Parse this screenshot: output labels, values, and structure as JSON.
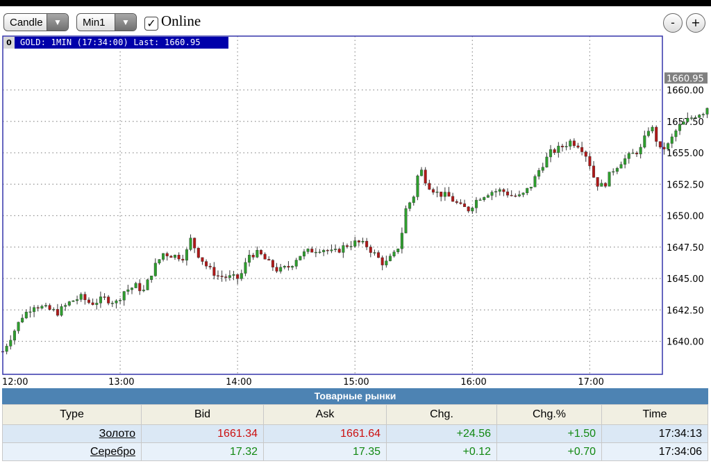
{
  "toolbar": {
    "chart_type": "Candle",
    "interval": "Min1",
    "online_label": "Online",
    "zoom_out": "-",
    "zoom_in": "+"
  },
  "chart_info": {
    "index": "0",
    "text": "GOLD: 1MIN (17:34:00) Last: 1660.95"
  },
  "colors": {
    "up": "#2e9e2e",
    "down": "#b01818",
    "grid": "#909090",
    "frame": "#3333aa",
    "last_tag": "#808080"
  },
  "chart_data": {
    "type": "candlestick",
    "symbol": "GOLD",
    "interval": "1MIN",
    "last_value": 1660.95,
    "last_label": "1660.95",
    "xlabels": [
      "12:00",
      "13:00",
      "14:00",
      "15:00",
      "16:00",
      "17:00"
    ],
    "yticks": [
      "1640.00",
      "1642.50",
      "1645.00",
      "1647.50",
      "1650.00",
      "1652.50",
      "1655.00",
      "1657.50",
      "1660.00"
    ],
    "ylim": [
      1638.25,
      1662.5
    ],
    "xlim_minutes": [
      0,
      340
    ],
    "grid": true,
    "series": [
      {
        "t": 0,
        "v": 1639.2
      },
      {
        "t": 5,
        "v": 1640.6
      },
      {
        "t": 10,
        "v": 1642.0
      },
      {
        "t": 16,
        "v": 1642.9
      },
      {
        "t": 22,
        "v": 1642.6
      },
      {
        "t": 28,
        "v": 1642.3
      },
      {
        "t": 35,
        "v": 1643.2
      },
      {
        "t": 40,
        "v": 1643.5
      },
      {
        "t": 45,
        "v": 1643.0
      },
      {
        "t": 52,
        "v": 1643.4
      },
      {
        "t": 58,
        "v": 1643.1
      },
      {
        "t": 62,
        "v": 1644.0
      },
      {
        "t": 68,
        "v": 1644.4
      },
      {
        "t": 72,
        "v": 1644.0
      },
      {
        "t": 77,
        "v": 1645.8
      },
      {
        "t": 82,
        "v": 1647.0
      },
      {
        "t": 88,
        "v": 1646.8
      },
      {
        "t": 93,
        "v": 1646.7
      },
      {
        "t": 96,
        "v": 1648.1
      },
      {
        "t": 100,
        "v": 1646.9
      },
      {
        "t": 105,
        "v": 1645.8
      },
      {
        "t": 110,
        "v": 1645.2
      },
      {
        "t": 115,
        "v": 1645.1
      },
      {
        "t": 121,
        "v": 1645.0
      },
      {
        "t": 126,
        "v": 1646.9
      },
      {
        "t": 131,
        "v": 1647.0
      },
      {
        "t": 136,
        "v": 1646.2
      },
      {
        "t": 141,
        "v": 1645.6
      },
      {
        "t": 147,
        "v": 1646.0
      },
      {
        "t": 151,
        "v": 1646.8
      },
      {
        "t": 157,
        "v": 1647.2
      },
      {
        "t": 163,
        "v": 1647.4
      },
      {
        "t": 169,
        "v": 1647.0
      },
      {
        "t": 175,
        "v": 1647.6
      },
      {
        "t": 181,
        "v": 1647.9
      },
      {
        "t": 186,
        "v": 1647.6
      },
      {
        "t": 192,
        "v": 1646.6
      },
      {
        "t": 195,
        "v": 1646.1
      },
      {
        "t": 200,
        "v": 1646.9
      },
      {
        "t": 203,
        "v": 1647.8
      },
      {
        "t": 206,
        "v": 1650.5
      },
      {
        "t": 210,
        "v": 1651.6
      },
      {
        "t": 213,
        "v": 1653.9
      },
      {
        "t": 217,
        "v": 1652.5
      },
      {
        "t": 222,
        "v": 1651.8
      },
      {
        "t": 228,
        "v": 1651.5
      },
      {
        "t": 234,
        "v": 1650.7
      },
      {
        "t": 238,
        "v": 1650.5
      },
      {
        "t": 243,
        "v": 1651.4
      },
      {
        "t": 249,
        "v": 1651.9
      },
      {
        "t": 255,
        "v": 1652.0
      },
      {
        "t": 260,
        "v": 1651.6
      },
      {
        "t": 265,
        "v": 1651.5
      },
      {
        "t": 270,
        "v": 1652.4
      },
      {
        "t": 275,
        "v": 1653.9
      },
      {
        "t": 280,
        "v": 1655.0
      },
      {
        "t": 285,
        "v": 1655.4
      },
      {
        "t": 290,
        "v": 1655.9
      },
      {
        "t": 295,
        "v": 1655.6
      },
      {
        "t": 299,
        "v": 1654.6
      },
      {
        "t": 303,
        "v": 1652.6
      },
      {
        "t": 307,
        "v": 1652.3
      },
      {
        "t": 311,
        "v": 1653.5
      },
      {
        "t": 316,
        "v": 1654.3
      },
      {
        "t": 321,
        "v": 1654.8
      },
      {
        "t": 326,
        "v": 1655.3
      },
      {
        "t": 331,
        "v": 1657.3
      },
      {
        "t": 336,
        "v": 1655.2
      },
      {
        "t": 340,
        "v": 1655.6
      },
      {
        "t": 345,
        "v": 1657.0
      },
      {
        "t": 350,
        "v": 1657.6
      },
      {
        "t": 355,
        "v": 1658.1
      },
      {
        "t": 359,
        "v": 1658.3
      },
      {
        "t": 362,
        "v": 1659.3
      },
      {
        "t": 364,
        "v": 1660.95
      }
    ]
  },
  "table": {
    "caption": "Товарные рынки",
    "headers": [
      "Type",
      "Bid",
      "Ask",
      "Chg.",
      "Chg.%",
      "Time"
    ],
    "rows": [
      {
        "type": "Золото",
        "bid": "1661.34",
        "ask": "1661.64",
        "chg": "+24.56",
        "chg_pct": "+1.50",
        "time": "17:34:13"
      },
      {
        "type": "Серебро",
        "bid": "17.32",
        "ask": "17.35",
        "chg": "+0.12",
        "chg_pct": "+0.70",
        "time": "17:34:06"
      }
    ]
  }
}
